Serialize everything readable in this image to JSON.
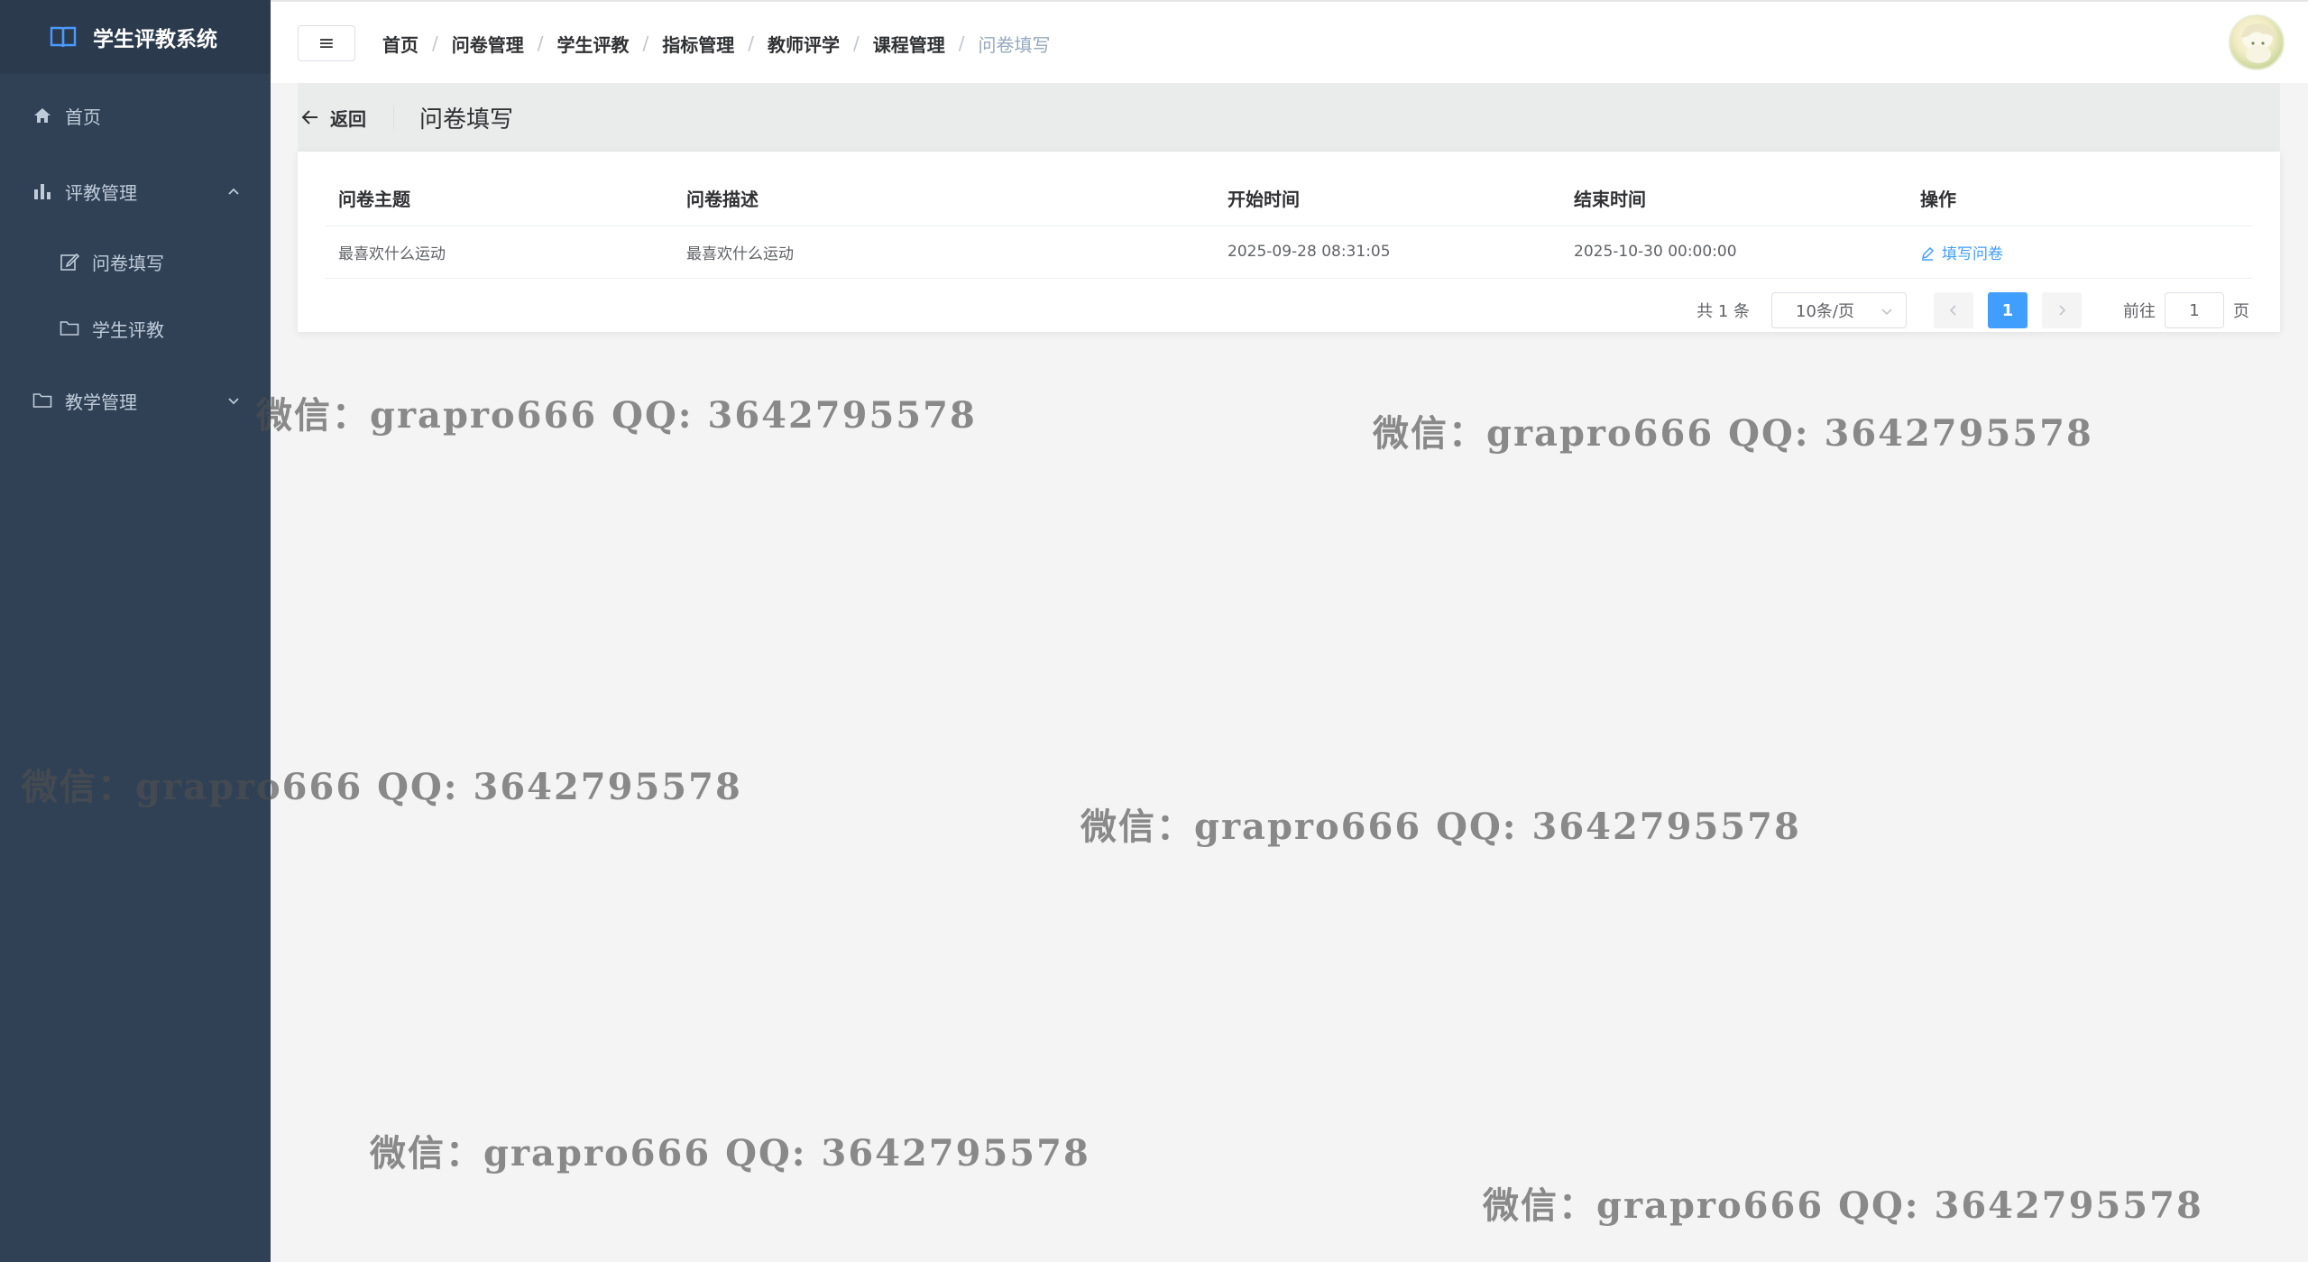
{
  "app": {
    "title": "学生评教系统"
  },
  "sidebar": {
    "items": [
      {
        "label": "首页",
        "icon": "home-icon"
      },
      {
        "label": "评教管理",
        "icon": "bar-chart-icon",
        "expanded": true
      },
      {
        "label": "问卷填写",
        "icon": "edit-icon",
        "sub": true
      },
      {
        "label": "学生评教",
        "icon": "folder-icon",
        "sub": true
      },
      {
        "label": "教学管理",
        "icon": "folder-icon",
        "expanded": false
      }
    ]
  },
  "breadcrumb": [
    "首页",
    "问卷管理",
    "学生评教",
    "指标管理",
    "教师评学",
    "课程管理",
    "问卷填写"
  ],
  "page_header": {
    "back_label": "返回",
    "title": "问卷填写"
  },
  "table": {
    "columns": [
      "问卷主题",
      "问卷描述",
      "开始时间",
      "结束时间",
      "操作"
    ],
    "rows": [
      {
        "topic": "最喜欢什么运动",
        "description": "最喜欢什么运动",
        "start": "2025-09-28 08:31:05",
        "end": "2025-10-30 00:00:00",
        "action": "填写问卷"
      }
    ]
  },
  "pagination": {
    "total_text": "共 1 条",
    "page_size": "10条/页",
    "current_page": "1",
    "goto_label": "前往",
    "goto_value": "1",
    "page_suffix": "页"
  },
  "watermarks": [
    "微信：grapro666 QQ: 3642795578",
    "微信：grapro666 QQ: 3642795578",
    "微信：grapro666 QQ: 3642795578",
    "微信：grapro666 QQ: 3642795578",
    "微信：grapro666 QQ: 3642795578",
    "微信：grapro666 QQ: 3642795578"
  ],
  "colors": {
    "sidebar_bg": "#304156",
    "logo_bg": "#2b3a4d",
    "accent": "#409eff",
    "text_primary": "#303133",
    "text_secondary": "#606266"
  }
}
